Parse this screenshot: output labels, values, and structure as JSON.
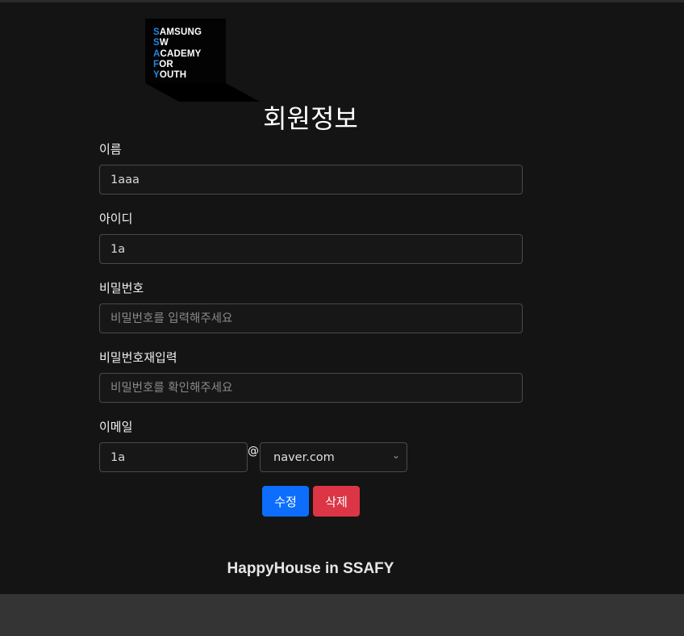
{
  "logo": {
    "lines": [
      {
        "first": "S",
        "rest": "AMSUNG"
      },
      {
        "first": "S",
        "rest": "W"
      },
      {
        "first": "A",
        "rest": "CADEMY"
      },
      {
        "first": "F",
        "rest": "OR"
      },
      {
        "first": "Y",
        "rest": "OUTH"
      }
    ]
  },
  "page_title": "회원정보",
  "form": {
    "name": {
      "label": "이름",
      "value": "1aaa"
    },
    "userid": {
      "label": "아이디",
      "value": "1a"
    },
    "password": {
      "label": "비밀번호",
      "placeholder": "비밀번호를 입력해주세요"
    },
    "password_confirm": {
      "label": "비밀번호재입력",
      "placeholder": "비밀번호를 확인해주세요"
    },
    "email": {
      "label": "이메일",
      "id_value": "1a",
      "at": "@",
      "domain_selected": "naver.com"
    }
  },
  "buttons": {
    "edit": "수정",
    "delete": "삭제"
  },
  "colors": {
    "edit": "#0d6efd",
    "delete": "#dc3545",
    "logo_accent": "#1e88e5"
  },
  "footer": "HappyHouse in SSAFY"
}
